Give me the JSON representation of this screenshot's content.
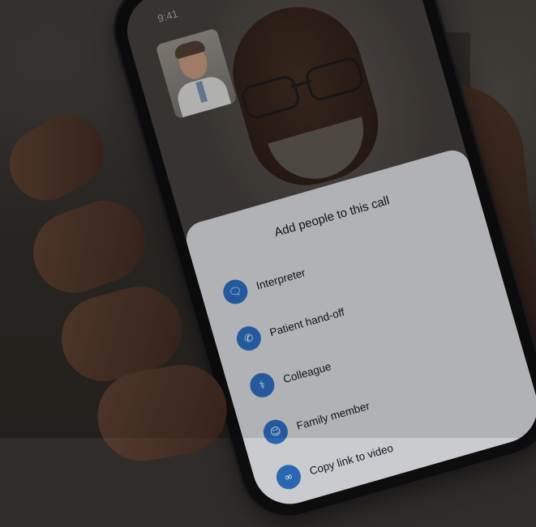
{
  "status_bar": {
    "time": "9:41"
  },
  "sheet": {
    "title": "Add people to this call",
    "options": [
      {
        "label": "Interpreter",
        "icon": "interpreter-icon"
      },
      {
        "label": "Patient hand-off",
        "icon": "phone-transfer-icon"
      },
      {
        "label": "Colleague",
        "icon": "stethoscope-icon"
      },
      {
        "label": "Family member",
        "icon": "person-icon"
      },
      {
        "label": "Copy link to video",
        "icon": "link-icon"
      }
    ]
  },
  "colors": {
    "accent": "#2a67b3",
    "sheet": "#c9cbcf"
  }
}
